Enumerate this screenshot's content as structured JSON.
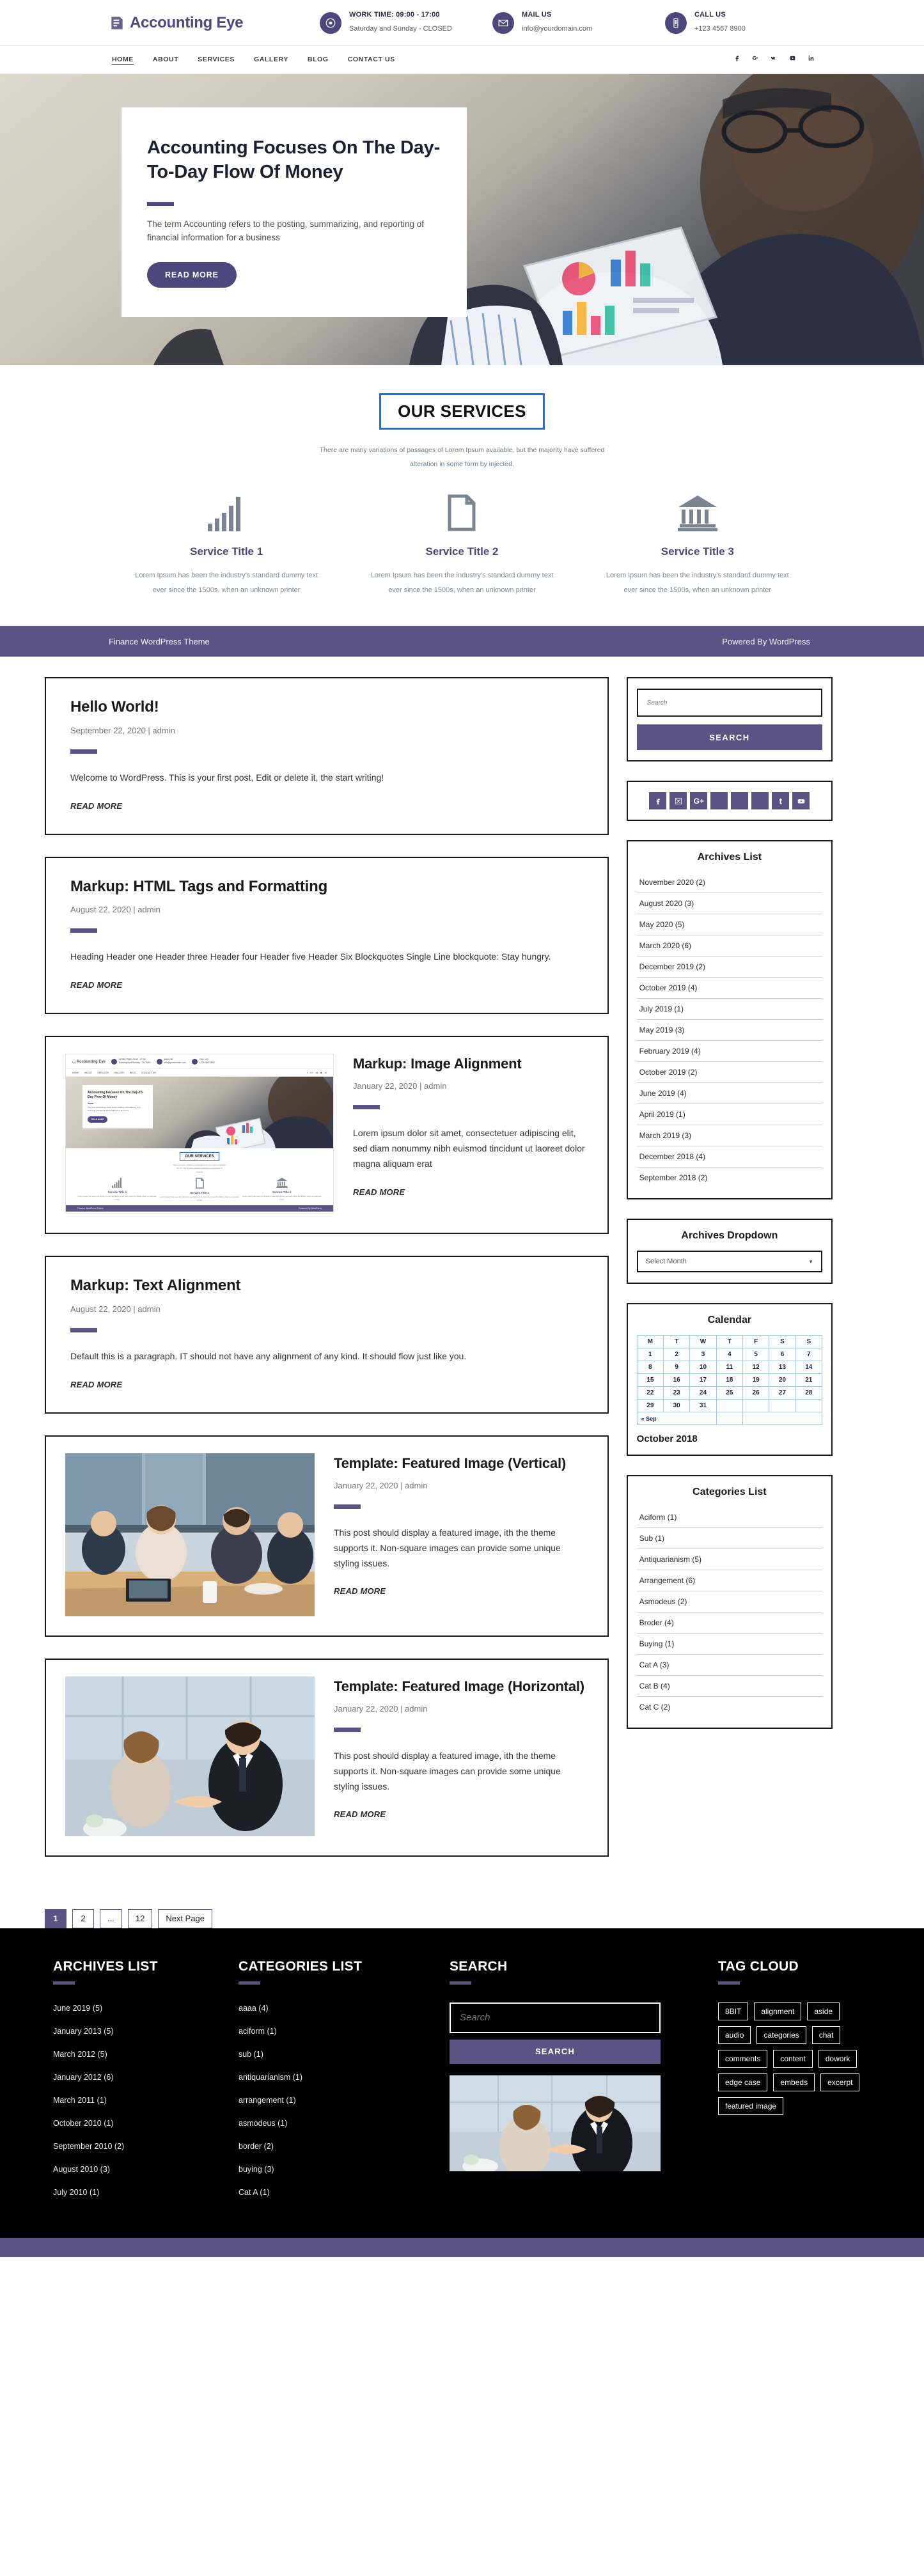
{
  "header": {
    "logo_text": "Accounting Eye",
    "info": [
      {
        "icon": "clock-icon",
        "label": "WORK TIME: 09:00 - 17:00",
        "value": "Saturday and Sunday - CLOSED"
      },
      {
        "icon": "envelope-icon",
        "label": "MAIL US",
        "value": "info@yourdomain.com"
      },
      {
        "icon": "phone-icon",
        "label": "CALL US",
        "value": "+123 4567 8900"
      }
    ]
  },
  "nav": {
    "items": [
      "HOME",
      "ABOUT",
      "SERVICES",
      "GALLERY",
      "BLOG",
      "CONTACT US"
    ],
    "active": "HOME",
    "social": [
      "facebook-icon",
      "google-plus-icon",
      "vk-icon",
      "youtube-icon",
      "linkedin-icon"
    ]
  },
  "hero": {
    "title": "Accounting Focuses On The Day-To-Day Flow Of Money",
    "text": "The term Accounting refers to the posting, summarizing, and reporting of financial information for a business",
    "button": "READ MORE"
  },
  "services": {
    "title": "OUR SERVICES",
    "subtitle": "There are many variations of passages of Lorem Ipsum available, but the majority have suffered alteration in some form by injected.",
    "items": [
      {
        "icon": "bar-chart-icon",
        "title": "Service Title 1",
        "text": "Lorem Ipsum has been the industry's standard dummy text ever since the 1500s, when an unknown printer"
      },
      {
        "icon": "document-icon",
        "title": "Service Title 2",
        "text": "Lorem Ipsum has been the industry's standard dummy text ever since the 1500s, when an unknown printer"
      },
      {
        "icon": "bank-icon",
        "title": "Service Title 3",
        "text": "Lorem Ipsum has been the industry's standard dummy text ever since the 1500s, when an unknown printer"
      }
    ]
  },
  "strip": {
    "left": "Finance WordPress Theme",
    "right": "Powered By WordPress"
  },
  "posts": [
    {
      "title": "Hello World!",
      "meta": "September 22, 2020 | admin",
      "body": "Welcome to WordPress. This is your first post, Edit or delete it, the start writing!",
      "more": "READ MORE"
    },
    {
      "title": "Markup: HTML Tags and Formatting",
      "meta": "August 22, 2020 | admin",
      "body": "Heading Header one Header three Header four Header five Header Six Blockquotes Single Line blockquote: Stay hungry.",
      "more": "READ MORE"
    },
    {
      "title": "Markup: Image Alignment",
      "meta": "January 22, 2020 | admin",
      "body": "Lorem ipsum dolor sit amet, consectetuer adipiscing elit, sed diam nonummy nibh euismod tincidunt ut laoreet dolor magna aliquam erat",
      "more": "READ MORE",
      "thumb": "site-screenshot-thumbnail"
    },
    {
      "title": "Markup: Text Alignment",
      "meta": "August 22, 2020 | admin",
      "body": "Default this is a paragraph. IT should not have any alignment of any kind. It should flow just like you.",
      "more": "READ MORE"
    },
    {
      "title": "Template: Featured Image (Vertical)",
      "meta": "January 22, 2020 | admin",
      "body": "This post should display a featured image, ith the theme supports it. Non-square images can provide some unique styling issues.",
      "more": "READ MORE",
      "thumb": "office-meeting-photo"
    },
    {
      "title": "Template: Featured Image (Horizontal)",
      "meta": "January 22, 2020 | admin",
      "body": "This post should display a featured image, ith the theme supports it. Non-square images can provide some unique styling issues.",
      "more": "READ MORE",
      "thumb": "handshake-photo"
    }
  ],
  "pagination": {
    "pages": [
      "1",
      "2",
      "...",
      "12",
      "Next Page"
    ],
    "current": "1"
  },
  "sidebar": {
    "search": {
      "placeholder": "Search",
      "button": "SEARCH"
    },
    "social": [
      "facebook-icon",
      "twitter-x-icon",
      "google-plus-icon",
      "blank-icon",
      "blank-icon",
      "blank-icon",
      "tumblr-icon",
      "youtube-icon"
    ],
    "archives_list": {
      "title": "Archives List",
      "items": [
        "November 2020 (2)",
        "August 2020 (3)",
        "May 2020 (5)",
        "March 2020 (6)",
        "December 2019 (2)",
        "October 2019 (4)",
        "July 2019 (1)",
        "May 2019 (3)",
        "February 2019 (4)",
        "October 2019 (2)",
        "June 2019 (4)",
        "April 2019 (1)",
        "March 2019 (3)",
        "December 2018 (4)",
        "September 2018 (2)"
      ]
    },
    "archives_dropdown": {
      "title": "Archives Dropdown",
      "selected": "Select Month"
    },
    "calendar": {
      "title": "Calendar",
      "weekdays": [
        "M",
        "T",
        "W",
        "T",
        "F",
        "S",
        "S"
      ],
      "weeks": [
        [
          "1",
          "2",
          "3",
          "4",
          "5",
          "6",
          "7"
        ],
        [
          "8",
          "9",
          "10",
          "11",
          "12",
          "13",
          "14"
        ],
        [
          "15",
          "16",
          "17",
          "18",
          "19",
          "20",
          "21"
        ],
        [
          "22",
          "23",
          "24",
          "25",
          "26",
          "27",
          "28"
        ],
        [
          "29",
          "30",
          "31",
          "",
          "",
          "",
          ""
        ]
      ],
      "prev": "« Sep",
      "month_label": "October 2018"
    },
    "categories_list": {
      "title": "Categories List",
      "items": [
        "Aciform (1)",
        "Sub (1)",
        "Antiquarianism (5)",
        "Arrangement (6)",
        "Asmodeus (2)",
        "Broder (4)",
        "Buying (1)",
        "Cat A (3)",
        "Cat B (4)",
        "Cat C (2)"
      ]
    }
  },
  "footer": {
    "archives": {
      "title": "ARCHIVES LIST",
      "items": [
        "June 2019 (5)",
        "January  2013 (5)",
        "March 2012 (5)",
        "January  2012 (6)",
        "March  2011 (1)",
        "October 2010 (1)",
        "September 2010 (2)",
        "August 2010 (3)",
        "July 2010 (1)"
      ]
    },
    "categories": {
      "title": "CATEGORIES LIST",
      "items": [
        "aaaa (4)",
        "aciform (1)",
        "sub (1)",
        "antiquarianism (1)",
        "arrangement (1)",
        "asmodeus (1)",
        "border (2)",
        "buying (3)",
        "Cat A (1)"
      ]
    },
    "search": {
      "title": "SEARCH",
      "placeholder": "Search",
      "button": "SEARCH",
      "image": "handshake-photo"
    },
    "tagcloud": {
      "title": "TAG CLOUD",
      "tags": [
        "8BIT",
        "alignment",
        "aside",
        "audio",
        "categories",
        "chat",
        "comments",
        "content",
        "dowork",
        "edge case",
        "embeds",
        "excerpt",
        "featured image"
      ]
    }
  },
  "colors": {
    "accent": "#4d477e",
    "strip": "#5a5384",
    "title_border": "#1d6fe0",
    "footer_bg": "#000000"
  }
}
